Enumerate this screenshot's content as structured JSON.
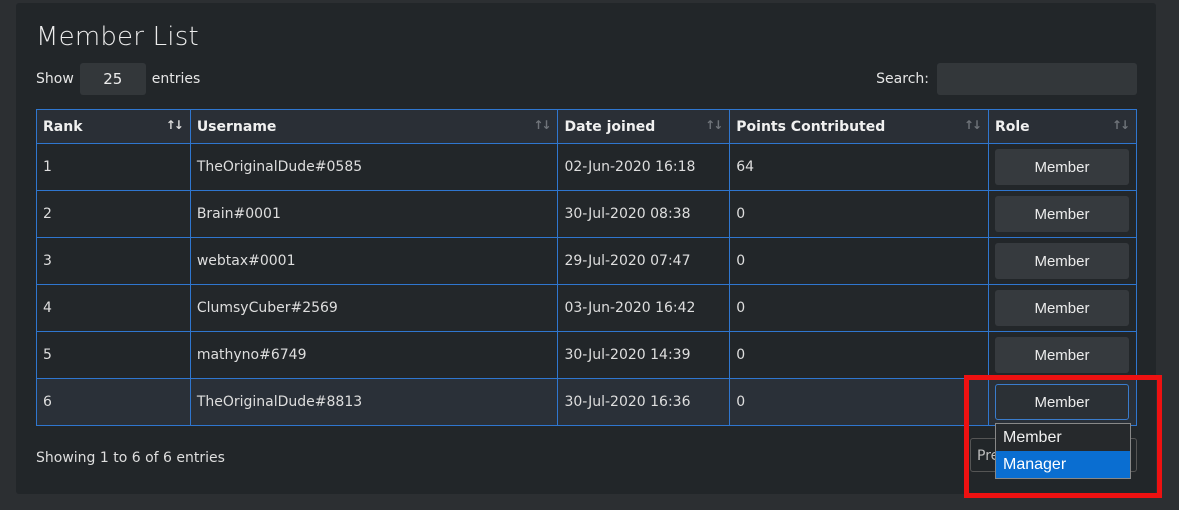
{
  "page": {
    "title": "Member List",
    "show_label": "Show",
    "entries_value": "25",
    "entries_label": "entries",
    "search_label": "Search:",
    "search_value": ""
  },
  "table": {
    "headers": [
      "Rank",
      "Username",
      "Date joined",
      "Points Contributed",
      "Role"
    ],
    "rows": [
      {
        "rank": "1",
        "username": "TheOriginalDude#0585",
        "date": "02-Jun-2020 16:18",
        "points": "64",
        "role": "Member"
      },
      {
        "rank": "2",
        "username": "Brain#0001",
        "date": "30-Jul-2020 08:38",
        "points": "0",
        "role": "Member"
      },
      {
        "rank": "3",
        "username": "webtax#0001",
        "date": "29-Jul-2020 07:47",
        "points": "0",
        "role": "Member"
      },
      {
        "rank": "4",
        "username": "ClumsyCuber#2569",
        "date": "03-Jun-2020 16:42",
        "points": "0",
        "role": "Member"
      },
      {
        "rank": "5",
        "username": "mathyno#6749",
        "date": "30-Jul-2020 14:39",
        "points": "0",
        "role": "Member"
      },
      {
        "rank": "6",
        "username": "TheOriginalDude#8813",
        "date": "30-Jul-2020 16:36",
        "points": "0",
        "role": "Member"
      }
    ]
  },
  "footer": {
    "info": "Showing 1 to 6 of 6 entries",
    "prev_label": "Pre"
  },
  "role_dropdown": {
    "options": [
      "Member",
      "Manager"
    ],
    "highlighted": "Manager"
  },
  "colors": {
    "accent_border": "#2f76cf",
    "selection": "#0a6ed1",
    "highlight_box": "#ee1111"
  }
}
